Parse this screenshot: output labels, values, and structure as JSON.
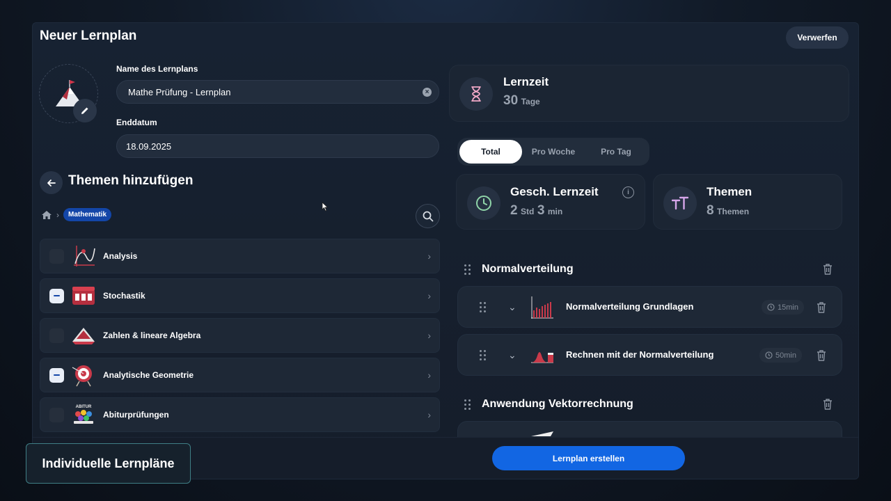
{
  "header": {
    "title": "Neuer Lernplan",
    "discard_label": "Verwerfen"
  },
  "form": {
    "name_label": "Name des Lernplans",
    "name_value": "Mathe Prüfung - Lernplan",
    "end_label": "Enddatum",
    "end_value": "18.09.2025"
  },
  "topics": {
    "title": "Themen hinzufügen",
    "breadcrumb": "Mathematik",
    "items": [
      {
        "label": "Analysis",
        "selected": false
      },
      {
        "label": "Stochastik",
        "selected": true
      },
      {
        "label": "Zahlen & lineare Algebra",
        "selected": false
      },
      {
        "label": "Analytische Geometrie",
        "selected": true
      },
      {
        "label": "Abiturprüfungen",
        "selected": false
      }
    ],
    "abitur_badge": "ABITUR"
  },
  "summary": {
    "lernzeit_title": "Lernzeit",
    "lernzeit_value": "30",
    "lernzeit_unit": "Tage",
    "tabs": [
      "Total",
      "Pro Woche",
      "Pro Tag"
    ],
    "active_tab": "Total",
    "est_title": "Gesch. Lernzeit",
    "est_hours": "2",
    "est_hours_unit": "Std",
    "est_minutes": "3",
    "est_minutes_unit": "min",
    "themes_title": "Themen",
    "themes_value": "8",
    "themes_unit": "Themen"
  },
  "plan": {
    "groups": [
      {
        "title": "Normalverteilung",
        "lessons": [
          {
            "title": "Normalverteilung Grundlagen",
            "duration": "15min"
          },
          {
            "title": "Rechnen mit der Normalverteilung",
            "duration": "50min"
          }
        ]
      },
      {
        "title": "Anwendung Vektorrechnung"
      }
    ]
  },
  "footer": {
    "create_label": "Lernplan erstellen"
  },
  "caption": "Individuelle Lernpläne",
  "colors": {
    "accent": "#1266e3",
    "badge": "#1346a8",
    "caption_border": "#3f7f86"
  }
}
